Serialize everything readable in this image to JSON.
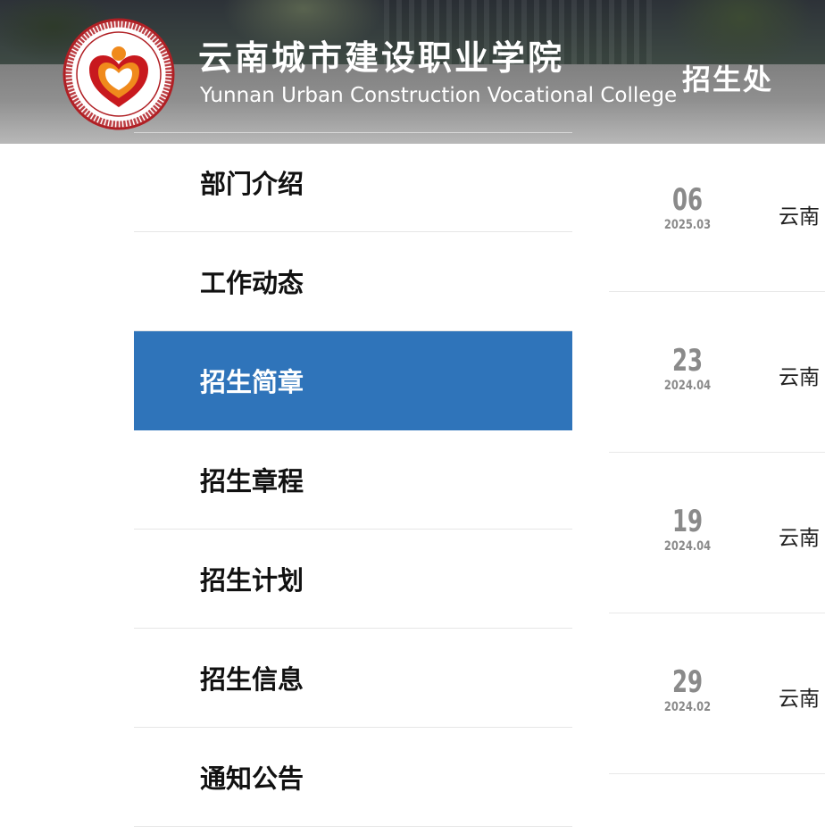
{
  "header": {
    "college_name_cn": "云南城市建设职业学院",
    "college_name_en": "Yunnan Urban Construction Vocational College",
    "department": "招生处",
    "logo_ring_text": "云南城市建设职业学院 Yunnan Urban Construction Vocational College"
  },
  "sidebar": {
    "active_index": 2,
    "items": [
      {
        "label": "部门介绍"
      },
      {
        "label": "工作动态"
      },
      {
        "label": "招生简章"
      },
      {
        "label": "招生章程"
      },
      {
        "label": "招生计划"
      },
      {
        "label": "招生信息"
      },
      {
        "label": "通知公告"
      }
    ]
  },
  "news": {
    "items": [
      {
        "day": "06",
        "year_month": "2025.03",
        "title": "云南"
      },
      {
        "day": "23",
        "year_month": "2024.04",
        "title": "云南"
      },
      {
        "day": "19",
        "year_month": "2024.04",
        "title": "云南"
      },
      {
        "day": "29",
        "year_month": "2024.02",
        "title": "云南"
      }
    ]
  },
  "colors": {
    "active_nav": "#2f74ba",
    "logo_red": "#c8191e",
    "logo_orange": "#f08a1c"
  }
}
